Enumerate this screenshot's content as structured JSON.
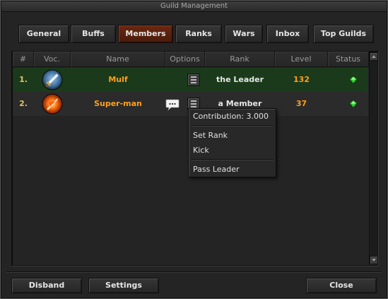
{
  "window": {
    "title": "Guild Management"
  },
  "tabs": [
    {
      "label": "General",
      "active": false
    },
    {
      "label": "Buffs",
      "active": false
    },
    {
      "label": "Members",
      "active": true
    },
    {
      "label": "Ranks",
      "active": false
    },
    {
      "label": "Wars",
      "active": false
    },
    {
      "label": "Inbox",
      "active": false
    },
    {
      "label": "Top Guilds",
      "active": false
    }
  ],
  "table": {
    "headers": {
      "num": "#",
      "voc": "Voc.",
      "name": "Name",
      "options": "Options",
      "rank": "Rank",
      "level": "Level",
      "status": "Status"
    },
    "rows": [
      {
        "num": "1.",
        "voc_icon": "sword-vocation-icon",
        "name": "Mulf",
        "rank": "the Leader",
        "level": "132",
        "status_icon": "online-green-icon",
        "selected": true
      },
      {
        "num": "2.",
        "voc_icon": "fire-vocation-icon",
        "name": "Super-man",
        "rank": "a Member",
        "level": "37",
        "status_icon": "online-green-icon",
        "selected": false
      }
    ]
  },
  "context_menu": {
    "contribution": "Contribution: 3.000",
    "items": [
      "Set Rank",
      "Kick",
      "Pass Leader"
    ]
  },
  "footer": {
    "disband": "Disband",
    "settings": "Settings",
    "close": "Close"
  },
  "colors": {
    "active_tab": "#5a2210",
    "selected_row": "#1b3a1b",
    "name": "#ff9f1a",
    "status_online": "#2fd62f"
  }
}
